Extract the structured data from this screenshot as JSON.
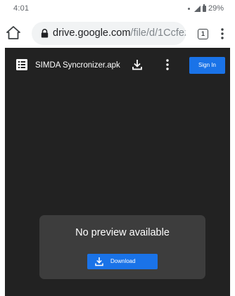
{
  "status_bar": {
    "time": "4:01",
    "battery": "29%"
  },
  "address_bar": {
    "host": "drive.google.com",
    "path": "/file/d/1Ccfez",
    "tab_count": "1"
  },
  "viewer": {
    "file_name": "SIMDA Syncronizer.apk",
    "sign_in_label": "Sign In",
    "no_preview_text": "No preview available",
    "download_label": "Download"
  },
  "colors": {
    "viewer_background": "#222222",
    "card_background": "#3d3d3d",
    "accent_blue": "#1a73e8"
  },
  "icons": [
    "home-icon",
    "lock-icon",
    "tab-switcher-icon",
    "menu-dots-icon",
    "file-icon",
    "download-icon",
    "more-vert-icon"
  ]
}
